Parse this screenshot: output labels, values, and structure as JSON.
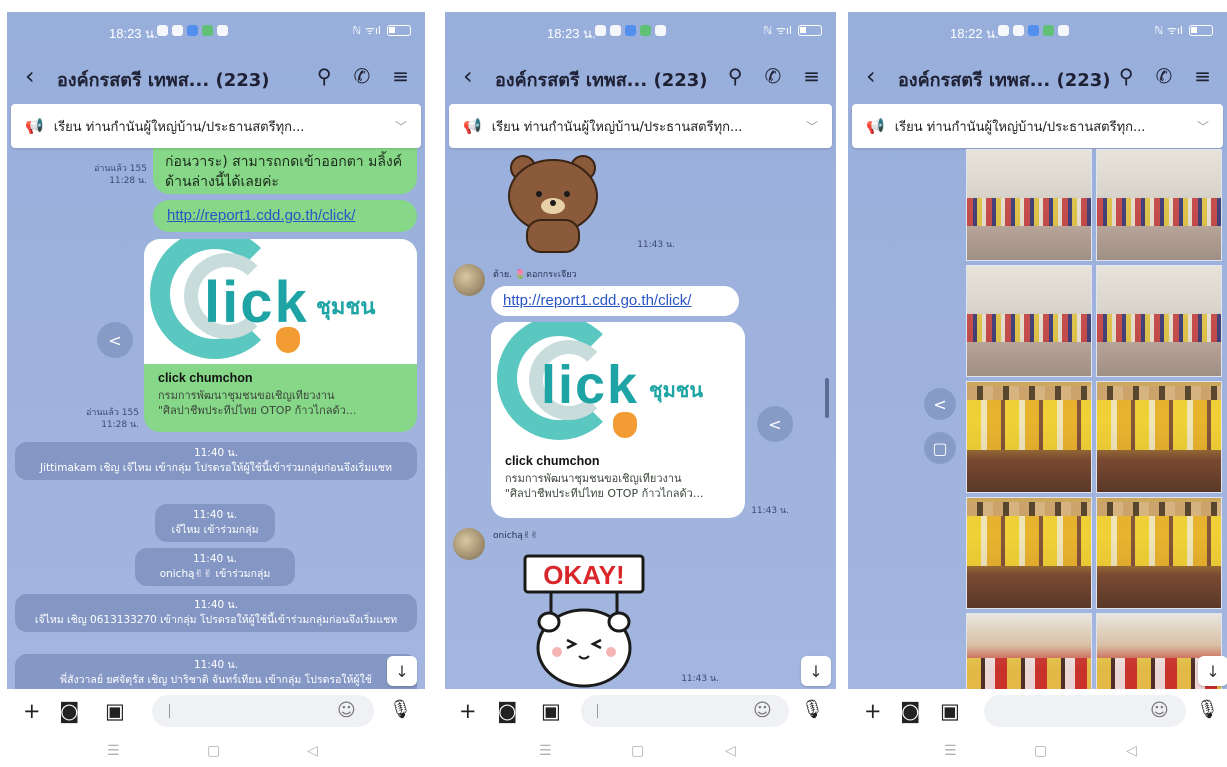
{
  "panels": [
    {
      "status_time": "18:23 น.",
      "status_right": "ℕ ᯤıl",
      "title": "องค์กรสตรี เทพส... (223)",
      "announcement": "เรียน ท่านกำนันผู้ใหญ่บ้าน/ประธานสตรีทุก...",
      "top_message_partial": "ก่อนวาระ) สามารถกดเข้าออกตา มลิ้งค์ด้านล่างนี้ได้เลยค่ะ",
      "read_meta_1": "อ่านแล้ว 155",
      "time_meta_1": "11:28 น.",
      "link": "http://report1.cdd.go.th/click/",
      "card_title": "click chumchon",
      "card_desc_1": "กรมการพัฒนาชุมชนขอเชิญเที่ยวงาน",
      "card_desc_2": "\"ศิลปาชีพประทีปไทย OTOP ก้าวไกลด้ว...",
      "logo_word": "lick",
      "logo_thai": "ชุมชน",
      "read_meta_2": "อ่านแล้ว 155",
      "time_meta_2": "11:28 น.",
      "system_messages": [
        {
          "time": "11:40 น.",
          "text": "Jittimakam เชิญ เจ๊ไหม เข้ากลุ่ม โปรดรอให้ผู้ใช้นี้เข้าร่วมกลุ่มก่อนจึงเริ่มแชท"
        },
        {
          "time": "11:40 น.",
          "text": "เจ๊ไหม เข้าร่วมกลุ่ม"
        },
        {
          "time": "11:40 น.",
          "text": "onichą✌✌ เข้าร่วมกลุ่ม"
        },
        {
          "time": "11:40 น.",
          "text": "เจ๊ไหม เชิญ 0613133270 เข้ากลุ่ม โปรดรอให้ผู้ใช้นี้เข้าร่วมกลุ่มก่อนจึงเริ่มแชท"
        },
        {
          "time": "11:40 น.",
          "text": "พี่สังวาลย์ ยศจัตุรัส เชิญ ปาริชาติ จันทร์เทียน เข้ากลุ่ม โปรดรอให้ผู้ใช้"
        }
      ]
    },
    {
      "status_time": "18:23 น.",
      "status_right": "ℕ ᯤıl",
      "title": "องค์กรสตรี เทพส... (223)",
      "announcement": "เรียน ท่านกำนันผู้ใหญ่บ้าน/ประธานสตรีทุก...",
      "sticker_time": "11:43 น.",
      "sender_1": "ต้าย. 🌷ดอกกระเจียว",
      "link": "http://report1.cdd.go.th/click/",
      "card_title": "click chumchon",
      "card_desc_1": "กรมการพัฒนาชุมชนขอเชิญเที่ยวงาน",
      "card_desc_2": "\"ศิลปาชีพประทีปไทย OTOP ก้าวไกลด้ว...",
      "logo_word": "lick",
      "logo_thai": "ชุมชน",
      "card_time": "11:43 น.",
      "sender_2": "onichą✌✌",
      "sticker_text": "OKAY!",
      "sticker2_time": "11:43 น."
    },
    {
      "status_time": "18:22 น.",
      "status_right": "ℕ ᯤıl",
      "title": "องค์กรสตรี เทพส... (223)",
      "announcement": "เรียน ท่านกำนันผู้ใหญ่บ้าน/ประธานสตรีทุก..."
    }
  ],
  "icons": {
    "back": "‹",
    "search": "⚲",
    "call": "✆",
    "menu": "≡",
    "megaphone": "📢",
    "chevron": "﹀",
    "share": "<",
    "down": "↓",
    "plus": "+",
    "camera": "◙",
    "image": "▣",
    "emoji": "☺",
    "mic": "🎙",
    "nav_menu": "☰",
    "nav_home": "▢",
    "nav_back": "◁"
  }
}
